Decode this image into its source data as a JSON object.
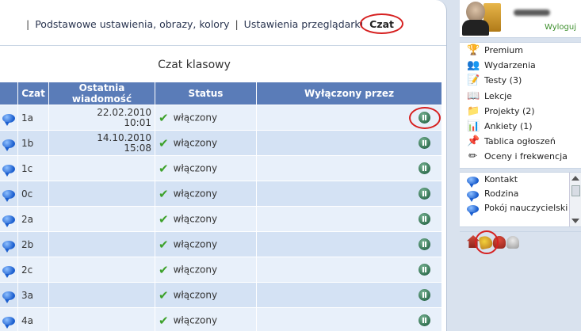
{
  "breadcrumb": {
    "link1": "Podstawowe ustawienia, obrazy, kolory",
    "link2": "Ustawienia przeglądarki",
    "active": "Czat"
  },
  "page_title": "Czat klasowy",
  "table": {
    "headers": [
      "Czat",
      "Ostatnia wiadomość",
      "Status",
      "Wyłączony przez"
    ],
    "rows": [
      {
        "icon": "chat-bubble-icon",
        "chat": "1a",
        "date": "22.02.2010",
        "time": "10:01",
        "status": "włączony",
        "action_icon": "pause-icon"
      },
      {
        "icon": "chat-bubble-icon",
        "chat": "1b",
        "date": "14.10.2010",
        "time": "15:08",
        "status": "włączony",
        "action_icon": "pause-icon"
      },
      {
        "icon": "chat-bubble-icon",
        "chat": "1c",
        "date": "",
        "time": "",
        "status": "włączony",
        "action_icon": "pause-icon"
      },
      {
        "icon": "chat-bubble-icon",
        "chat": "0c",
        "date": "",
        "time": "",
        "status": "włączony",
        "action_icon": "pause-icon"
      },
      {
        "icon": "chat-bubble-icon",
        "chat": "2a",
        "date": "",
        "time": "",
        "status": "włączony",
        "action_icon": "pause-icon"
      },
      {
        "icon": "chat-bubble-icon",
        "chat": "2b",
        "date": "",
        "time": "",
        "status": "włączony",
        "action_icon": "pause-icon"
      },
      {
        "icon": "chat-bubble-icon",
        "chat": "2c",
        "date": "",
        "time": "",
        "status": "włączony",
        "action_icon": "pause-icon"
      },
      {
        "icon": "chat-bubble-icon",
        "chat": "3a",
        "date": "",
        "time": "",
        "status": "włączony",
        "action_icon": "pause-icon"
      },
      {
        "icon": "chat-bubble-icon",
        "chat": "4a",
        "date": "",
        "time": "",
        "status": "włączony",
        "action_icon": "pause-icon"
      }
    ]
  },
  "user": {
    "logout": "Wyloguj"
  },
  "menu": [
    {
      "label": "Premium",
      "icon": "trophy-icon"
    },
    {
      "label": "Wydarzenia",
      "icon": "people-icon"
    },
    {
      "label": "Testy (3)",
      "icon": "test-icon"
    },
    {
      "label": "Lekcje",
      "icon": "book-icon"
    },
    {
      "label": "Projekty (2)",
      "icon": "project-icon"
    },
    {
      "label": "Ankiety (1)",
      "icon": "survey-icon"
    },
    {
      "label": "Tablica ogłoszeń",
      "icon": "notice-board-icon"
    },
    {
      "label": "Oceny i frekwencja",
      "icon": "grades-icon"
    }
  ],
  "contacts": [
    "Kontakt",
    "Rodzina",
    "Pokój nauczycielski"
  ],
  "colors": {
    "header_blue": "#5a7cb8",
    "row_light": "#e8f0fa",
    "row_dark": "#d4e2f4",
    "highlight_red": "#d62020",
    "logout_green": "#3b8e2a"
  }
}
